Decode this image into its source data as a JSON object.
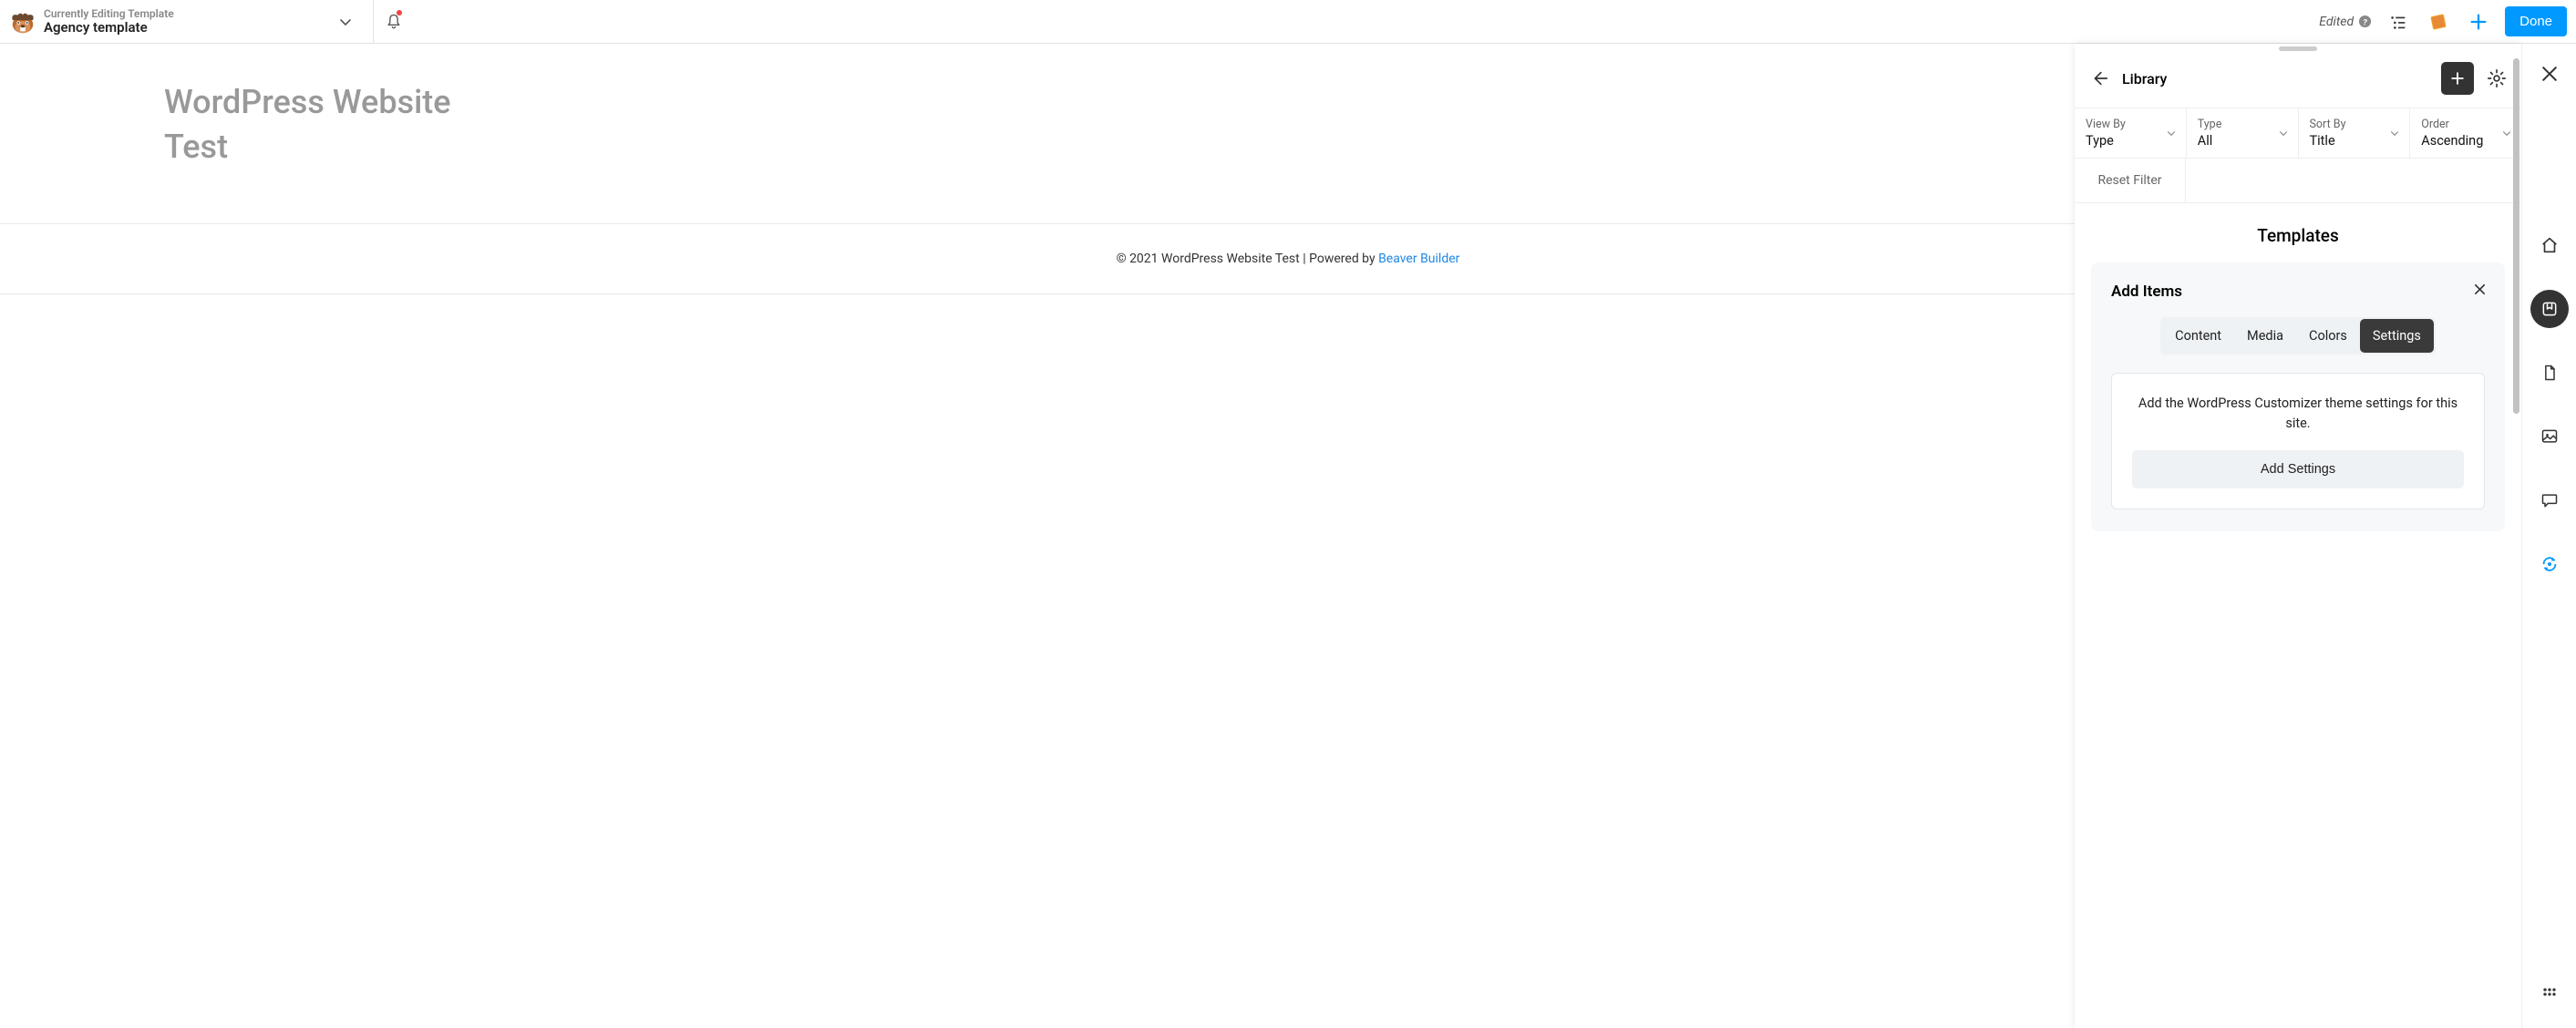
{
  "topbar": {
    "kicker": "Currently Editing Template",
    "title": "Agency template",
    "edited_label": "Edited",
    "done_label": "Done"
  },
  "canvas": {
    "heading_line1": "WordPress Website",
    "heading_line2": "Test",
    "footer_prefix": "© 2021 WordPress Website Test | Powered by ",
    "footer_link": "Beaver Builder"
  },
  "library": {
    "title": "Library",
    "filters": {
      "view_by": {
        "label": "View By",
        "value": "Type"
      },
      "type": {
        "label": "Type",
        "value": "All"
      },
      "sort_by": {
        "label": "Sort By",
        "value": "Title"
      },
      "order": {
        "label": "Order",
        "value": "Ascending"
      }
    },
    "reset_filter": "Reset Filter",
    "section_title": "Templates",
    "add_items": {
      "title": "Add Items",
      "tabs": [
        "Content",
        "Media",
        "Colors",
        "Settings"
      ],
      "active_tab": "Settings",
      "description": "Add the WordPress Customizer theme settings for this site.",
      "button": "Add Settings"
    }
  }
}
